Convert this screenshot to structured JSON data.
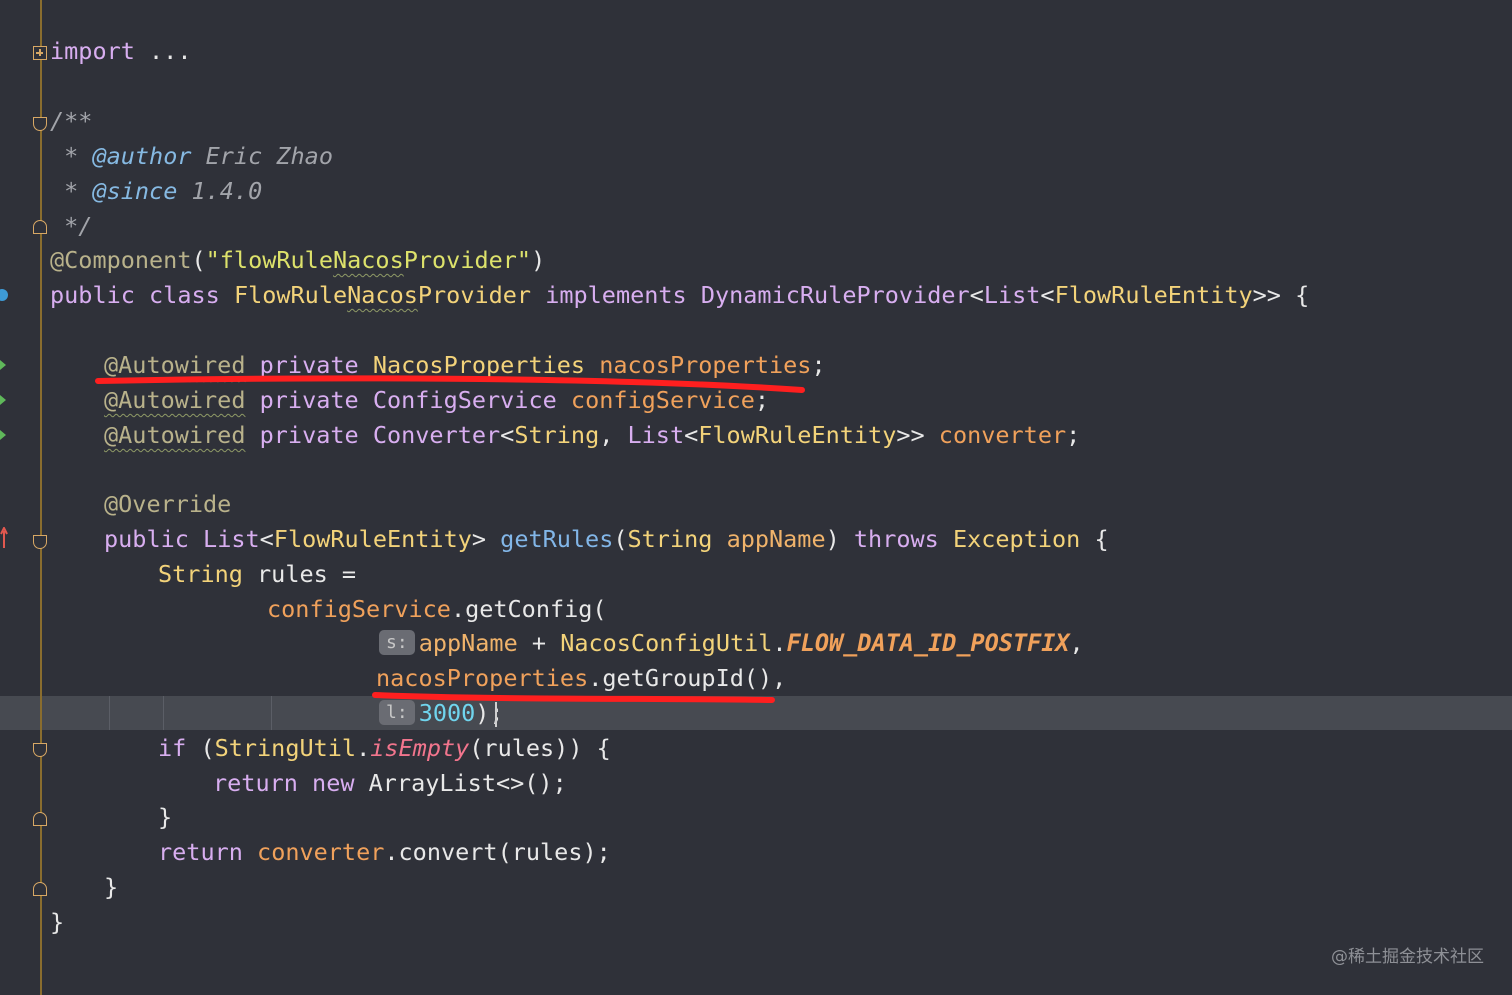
{
  "editor": {
    "language": "java",
    "lines": {
      "l1": {
        "kw": "import",
        "rest": " ..."
      },
      "l2": {
        "text": "/**"
      },
      "l3": {
        "star": " * ",
        "tag": "@author",
        "text": " Eric Zhao"
      },
      "l4": {
        "star": " * ",
        "tag": "@since",
        "text": " 1.4.0"
      },
      "l5": {
        "text": " */"
      },
      "l6": {
        "ann": "@Component",
        "open": "(",
        "str_pre": "\"flowRule",
        "str_mid": "Nacos",
        "str_post": "Provider\"",
        "close": ")"
      },
      "l7": {
        "kw1": "public class ",
        "cls1": "FlowRule",
        "cls_mid": "Nacos",
        "cls2": "Provider",
        "kw2": " implements ",
        "iface": "DynamicRuleProvider",
        "lt1": "<",
        "t1": "List",
        "lt2": "<",
        "t2": "FlowRuleEntity",
        "end": ">> {"
      },
      "l8": {
        "ann": "@Autowired",
        "kw": " private ",
        "type": "NacosProperties",
        "sp": " ",
        "field": "nacosProperties",
        "end": ";"
      },
      "l9": {
        "ann": "@Autowired",
        "kw": " private ",
        "type": "ConfigService",
        "sp": " ",
        "field": "configService",
        "end": ";"
      },
      "l10": {
        "ann": "@Autowired",
        "kw": " private ",
        "type": "Converter",
        "lt": "<",
        "t1": "String",
        "comma": ", ",
        "t2": "List",
        "lt2": "<",
        "t3": "FlowRuleEntity",
        "gt": ">> ",
        "field": "converter",
        "end": ";"
      },
      "l11": {
        "ann": "@Override"
      },
      "l12": {
        "kw": "public ",
        "type": "List",
        "lt": "<",
        "t1": "FlowRuleEntity",
        "gt": "> ",
        "meth": "getRules",
        "open": "(",
        "ptype": "String",
        "sp": " ",
        "param": "appName",
        "close": ") ",
        "throws": "throws ",
        "exc": "Exception",
        "end": " {"
      },
      "l13": {
        "type": "String",
        "rest": " rules ="
      },
      "l14": {
        "field": "configService",
        "rest": ".getConfig("
      },
      "l15": {
        "hint": "s:",
        "param": "appName",
        "plus": " + ",
        "cls": "NacosConfigUtil",
        "dot": ".",
        "const": "FLOW_DATA_ID_POSTFIX",
        "end": ","
      },
      "l16": {
        "field": "nacosProperties",
        "rest": ".getGroupId(),"
      },
      "l17": {
        "hint": "l:",
        "num": "3000",
        "end": ");"
      },
      "l18": {
        "kw": "if",
        "open": " (",
        "cls": "StringUtil",
        "dot": ".",
        "stat": "isEmpty",
        "rest": "(rules)) {"
      },
      "l19": {
        "kw1": "return ",
        "kw2": "new ",
        "rest": "ArrayList<>();"
      },
      "l20": {
        "text": "}"
      },
      "l21": {
        "kw": "return ",
        "field": "converter",
        "rest": ".convert(rules);"
      },
      "l22": {
        "text": "}"
      },
      "l23": {
        "text": "}"
      }
    },
    "colors": {
      "background": "#2f3139",
      "keyword": "#d8aef0",
      "class": "#f3d37a",
      "annotation": "#b9b28b",
      "field": "#f0a15b",
      "method": "#82b6e8",
      "number": "#70d5ee",
      "highlight_underline": "#ff1f1f"
    }
  },
  "watermark": "@稀土掘金技术社区"
}
